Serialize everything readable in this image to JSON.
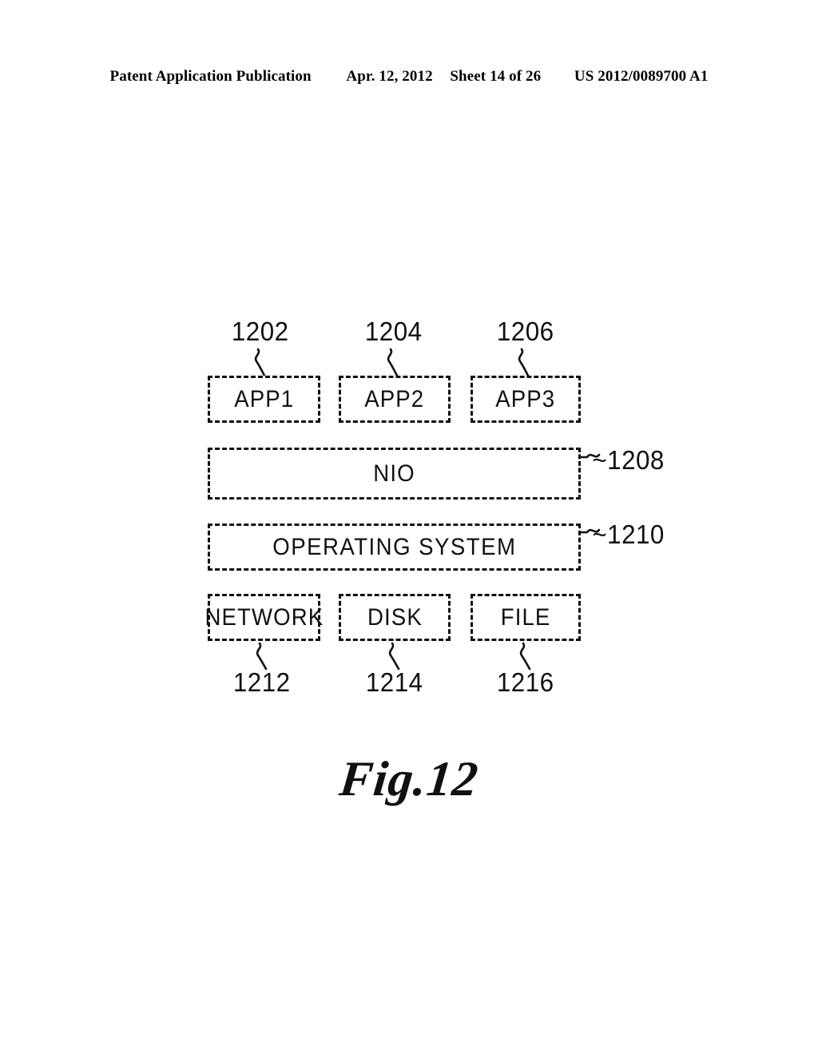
{
  "page": {
    "header": {
      "publication": "Patent Application Publication",
      "date": "Apr. 12, 2012",
      "sheet": "Sheet 14 of 26",
      "patent_number": "US 2012/0089700 A1"
    },
    "figure_caption": "Fig.12",
    "ink_color": "#111111",
    "background_color": "#ffffff"
  },
  "diagram": {
    "title": "Fig.12",
    "type": "block-diagram",
    "rows": [
      {
        "row_name": "applications",
        "boxes": [
          {
            "label": "APP1",
            "ref": "1202",
            "ref_position": "above"
          },
          {
            "label": "APP2",
            "ref": "1204",
            "ref_position": "above"
          },
          {
            "label": "APP3",
            "ref": "1206",
            "ref_position": "above"
          }
        ]
      },
      {
        "row_name": "nio-layer",
        "boxes": [
          {
            "label": "NIO",
            "ref": "~1208",
            "ref_position": "right"
          }
        ]
      },
      {
        "row_name": "operating-system-layer",
        "boxes": [
          {
            "label": "OPERATING SYSTEM",
            "ref": "~1210",
            "ref_position": "right"
          }
        ]
      },
      {
        "row_name": "resources",
        "boxes": [
          {
            "label": "NETWORK",
            "ref": "1212",
            "ref_position": "below"
          },
          {
            "label": "DISK",
            "ref": "1214",
            "ref_position": "below"
          },
          {
            "label": "FILE",
            "ref": "1216",
            "ref_position": "below"
          }
        ]
      }
    ]
  }
}
